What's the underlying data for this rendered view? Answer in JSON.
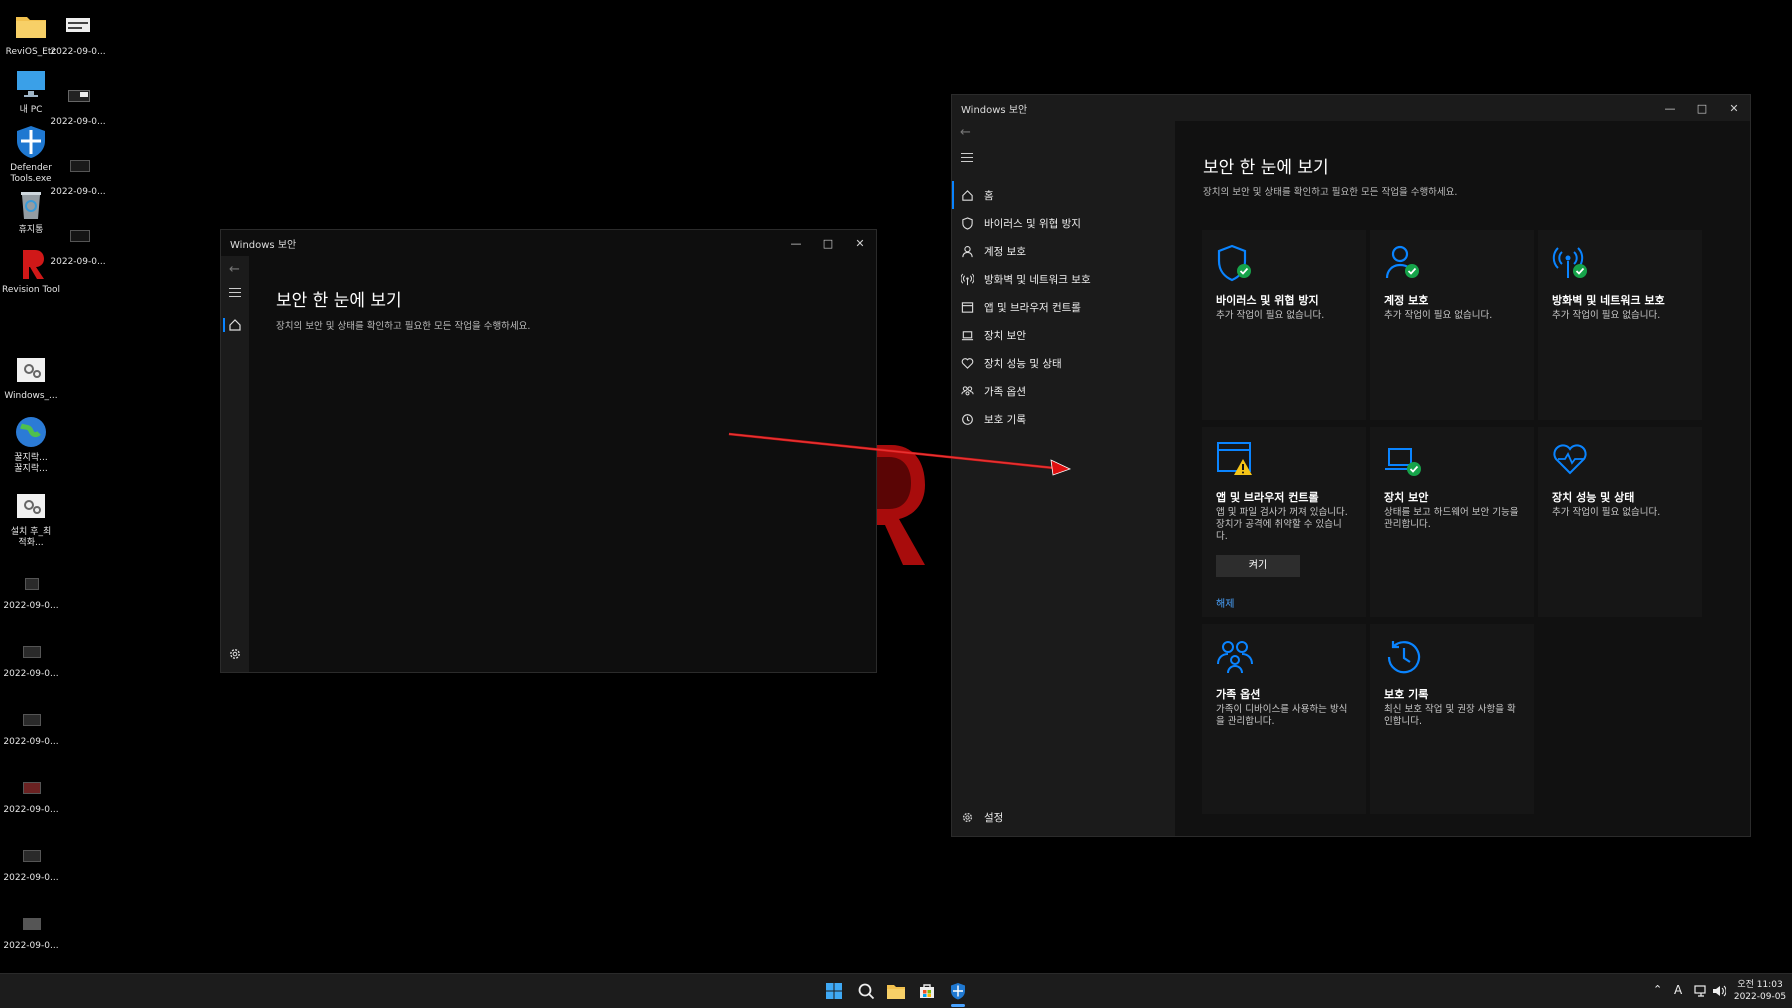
{
  "desktop": {
    "icons_col1": [
      {
        "label": "ReviOS_Etc",
        "icon": "folder-icon"
      },
      {
        "label": "내 PC",
        "icon": "monitor-icon"
      },
      {
        "label": "Defender Tools.exe",
        "icon": "defender-shield-icon"
      },
      {
        "label": "휴지통",
        "icon": "recycle-bin-icon"
      },
      {
        "label": "Revision Tool",
        "icon": "revision-logo-icon"
      },
      {
        "label": "Windows_...",
        "icon": "settings-file-icon"
      },
      {
        "label": "꿀지락... 꿀지락...",
        "icon": "globe-icon"
      },
      {
        "label": "설치 후_최적화...",
        "icon": "settings-file-icon"
      },
      {
        "label": "2022-09-0...",
        "icon": "screenshot-icon"
      },
      {
        "label": "2022-09-0...",
        "icon": "screenshot-icon"
      },
      {
        "label": "2022-09-0...",
        "icon": "screenshot-icon"
      },
      {
        "label": "2022-09-0...",
        "icon": "screenshot-icon"
      },
      {
        "label": "2022-09-0...",
        "icon": "screenshot-icon"
      },
      {
        "label": "2022-09-0...",
        "icon": "screenshot-icon"
      }
    ],
    "icons_col2": [
      {
        "label": "2022-09-0...",
        "icon": "screenshot-icon"
      },
      {
        "label": "2022-09-0...",
        "icon": "screenshot-icon"
      },
      {
        "label": "2022-09-0...",
        "icon": "screenshot-icon"
      },
      {
        "label": "2022-09-0...",
        "icon": "screenshot-icon"
      }
    ]
  },
  "small_window": {
    "title": "Windows 보안",
    "heading": "보안 한 눈에 보기",
    "subtitle": "장치의 보안 및 상태를 확인하고 필요한 모든 작업을 수행하세요."
  },
  "large_window": {
    "title": "Windows 보안",
    "heading": "보안 한 눈에 보기",
    "subtitle": "장치의 보안 및 상태를 확인하고 필요한 모든 작업을 수행하세요.",
    "nav": [
      {
        "label": "홈",
        "icon": "home-icon"
      },
      {
        "label": "바이러스 및 위협 방지",
        "icon": "shield-icon"
      },
      {
        "label": "계정 보호",
        "icon": "person-icon"
      },
      {
        "label": "방화벽 및 네트워크 보호",
        "icon": "antenna-icon"
      },
      {
        "label": "앱 및 브라우저 컨트롤",
        "icon": "app-window-icon"
      },
      {
        "label": "장치 보안",
        "icon": "laptop-icon"
      },
      {
        "label": "장치 성능 및 상태",
        "icon": "heart-icon"
      },
      {
        "label": "가족 옵션",
        "icon": "family-icon"
      },
      {
        "label": "보호 기록",
        "icon": "history-icon"
      }
    ],
    "settings_label": "설정",
    "tiles": [
      {
        "title": "바이러스 및 위협 방지",
        "sub": "추가 작업이 필요 없습니다.",
        "icon": "shield-check-icon"
      },
      {
        "title": "계정 보호",
        "sub": "추가 작업이 필요 없습니다.",
        "icon": "person-check-icon"
      },
      {
        "title": "방화벽 및 네트워크 보호",
        "sub": "추가 작업이 필요 없습니다.",
        "icon": "antenna-check-icon"
      },
      {
        "title": "앱 및 브라우저 컨트롤",
        "sub": "앱 및 파일 검사가 꺼져 있습니다. 장치가 공격에 취약할 수 있습니다.",
        "icon": "app-warning-icon",
        "button": "켜기",
        "link": "해제"
      },
      {
        "title": "장치 보안",
        "sub": "상태를 보고 하드웨어 보안 기능을 관리합니다.",
        "icon": "laptop-check-icon"
      },
      {
        "title": "장치 성능 및 상태",
        "sub": "추가 작업이 필요 없습니다.",
        "icon": "heart-pulse-icon"
      },
      {
        "title": "가족 옵션",
        "sub": "가족이 디바이스를 사용하는 방식을 관리합니다.",
        "icon": "family-icon"
      },
      {
        "title": "보호 기록",
        "sub": "최신 보호 작업 및 권장 사항을 확인합니다.",
        "icon": "history-icon"
      }
    ]
  },
  "taskbar": {
    "time": "오전 11:03",
    "date": "2022-09-05",
    "ime": "A"
  },
  "colors": {
    "accent": "#0a84ff",
    "ok_green": "#16a34a",
    "warn_yellow": "#f5c518",
    "arrow_red": "#e01010"
  }
}
